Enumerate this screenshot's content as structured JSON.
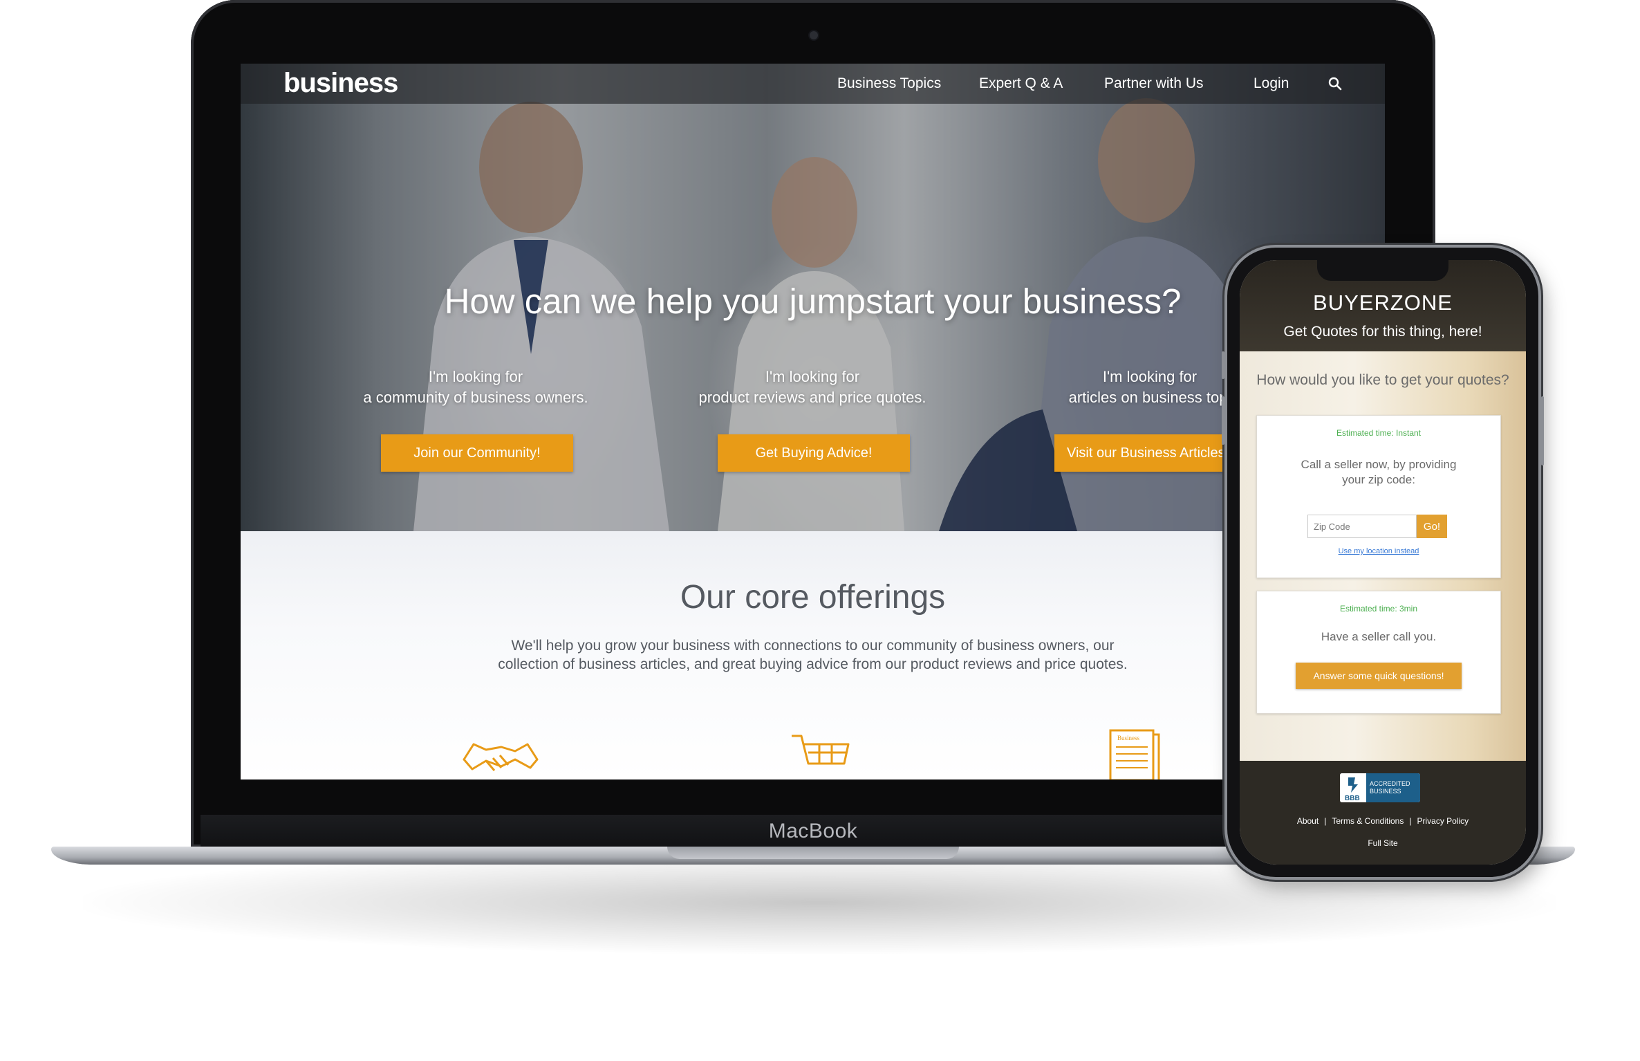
{
  "laptop": {
    "brand": "MacBook"
  },
  "site": {
    "logo": "business",
    "nav": [
      "Business Topics",
      "Expert Q & A",
      "Partner with Us",
      "Login"
    ],
    "hero_title": "How can we help you jumpstart your business?",
    "columns": [
      {
        "line1": "I'm looking for",
        "line2": "a community of business owners.",
        "cta": "Join our Community!"
      },
      {
        "line1": "I'm looking for",
        "line2": "product reviews and price quotes.",
        "cta": "Get Buying Advice!"
      },
      {
        "line1": "I'm looking for",
        "line2": "articles on business topi",
        "cta": "Visit our Business Articles"
      }
    ],
    "offerings_title": "Our core offerings",
    "offerings_line1": "We'll help you grow your business with connections to our community of business owners, our",
    "offerings_line2": "collection of business articles, and great buying advice from our product reviews and price quotes.",
    "icons": [
      "handshake-icon",
      "shopping-cart-icon",
      "newspaper-icon"
    ],
    "newspaper_label": "Business"
  },
  "phone": {
    "logo": "BUYERZONE",
    "tagline": "Get Quotes for this thing, here!",
    "question": "How would you like to get your quotes?",
    "card1": {
      "estimate": "Estimated time: Instant",
      "text1": "Call a seller now, by providing",
      "text2": "your zip code:",
      "zip_placeholder": "Zip Code",
      "go": "Go!",
      "link": "Use my location instead"
    },
    "card2": {
      "estimate": "Estimated time: 3min",
      "text": "Have a seller call you.",
      "button": "Answer some quick questions!"
    },
    "bbb_seal": "BBB",
    "bbb_line1": "ACCREDITED",
    "bbb_line2": "BUSINESS",
    "footer_links": [
      "About",
      "Terms & Conditions",
      "Privacy Policy"
    ],
    "full_site": "Full Site"
  },
  "colors": {
    "accent_orange": "#e89b17",
    "phone_button": "#e2a030",
    "estimate_green": "#4caf50",
    "bbb_blue": "#1d5f8a"
  }
}
